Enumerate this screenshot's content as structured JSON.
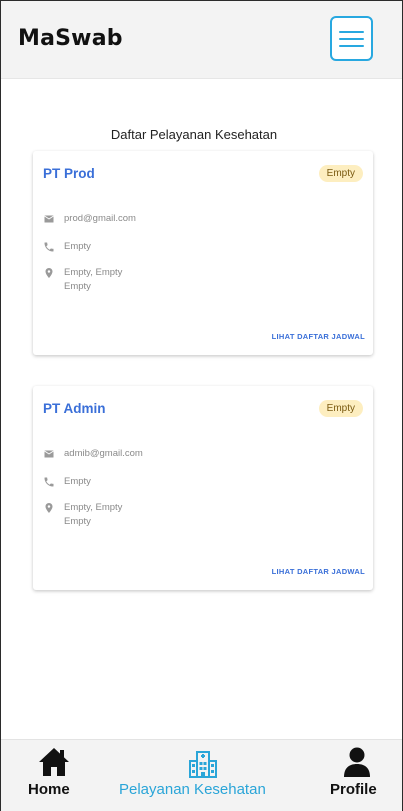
{
  "app": {
    "title": "MaSwab",
    "accent_color": "#28a8e0",
    "link_color": "#3a6fd8"
  },
  "main": {
    "section_title": "Daftar Pelayanan Kesehatan",
    "cards": [
      {
        "name": "PT Prod",
        "status": "Empty",
        "email": "prod@gmail.com",
        "phone": "Empty",
        "address_line1": "Empty, Empty",
        "address_line2": "Empty",
        "schedule_link": "LIHAT DAFTAR JADWAL"
      },
      {
        "name": "PT Admin",
        "status": "Empty",
        "email": "admib@gmail.com",
        "phone": "Empty",
        "address_line1": "Empty, Empty",
        "address_line2": "Empty",
        "schedule_link": "LIHAT DAFTAR JADWAL"
      }
    ]
  },
  "bottom_nav": {
    "items": [
      {
        "label": "Home",
        "icon": "home-icon",
        "active": false
      },
      {
        "label": "Pelayanan Kesehatan",
        "icon": "hospital-icon",
        "active": true
      },
      {
        "label": "Profile",
        "icon": "person-icon",
        "active": false
      }
    ],
    "active_color": "#2aa5d8"
  },
  "icons": {
    "menu": "hamburger-menu-icon",
    "email": "email-icon",
    "phone": "phone-icon",
    "location": "location-pin-icon"
  }
}
